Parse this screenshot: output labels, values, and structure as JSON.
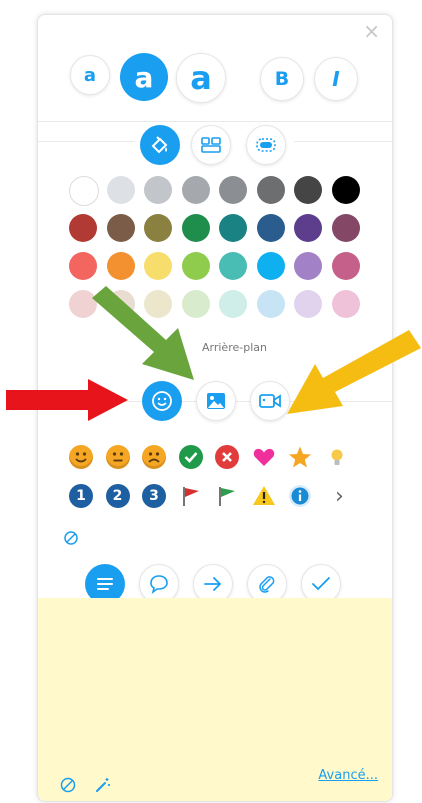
{
  "panel": {
    "close_symbol": "×"
  },
  "font_size_buttons": [
    {
      "label": "a"
    },
    {
      "label": "a"
    },
    {
      "label": "a"
    }
  ],
  "style_buttons": [
    {
      "label": "B"
    },
    {
      "label": "I"
    }
  ],
  "color_tabs": [
    "paint-bucket-icon",
    "layout-icon",
    "border-icon"
  ],
  "color_rows": [
    [
      "#ffffff",
      "#dde1e6",
      "#c2c5c9",
      "#a5a8ac",
      "#8b8e92",
      "#6c6e70",
      "#454545",
      "#000000"
    ],
    [
      "#b13a35",
      "#7b5c49",
      "#8a8040",
      "#1f8e4c",
      "#1a8283",
      "#2a5c8e",
      "#5c3e8d",
      "#854766"
    ],
    [
      "#f2665f",
      "#f39030",
      "#f7dd6b",
      "#8fcb4d",
      "#49bcb4",
      "#0fb0f0",
      "#a381c7",
      "#c5608a"
    ],
    [
      "#f0d2d3",
      "#e9dcd0",
      "#ebe6cc",
      "#d8eccd",
      "#cfede9",
      "#c7e4f5",
      "#e1d3ee",
      "#f0c2da"
    ]
  ],
  "background_label": "Arrière-plan",
  "media_tabs": [
    "smiley-icon",
    "image-icon",
    "video-icon"
  ],
  "icon_rows": {
    "row1": [
      "smile-emoji-icon",
      "neutral-emoji-icon",
      "sad-emoji-icon",
      "check-icon",
      "x-icon",
      "heart-icon",
      "star-icon",
      "lightbulb-icon"
    ],
    "row2_numbers": [
      "1",
      "2",
      "3"
    ],
    "row2_rest": [
      "red-flag-icon",
      "green-flag-icon",
      "warning-icon",
      "info-icon"
    ],
    "more": "›"
  },
  "shape_buttons": [
    "lines-icon",
    "speech-bubble-icon",
    "arrow-icon",
    "paperclip-icon",
    "check-icon"
  ],
  "footer": {
    "advanced_link": "Avancé..."
  },
  "arrows": {
    "red": "#e8141b",
    "green": "#6aa43c",
    "yellow": "#f5bd12"
  }
}
